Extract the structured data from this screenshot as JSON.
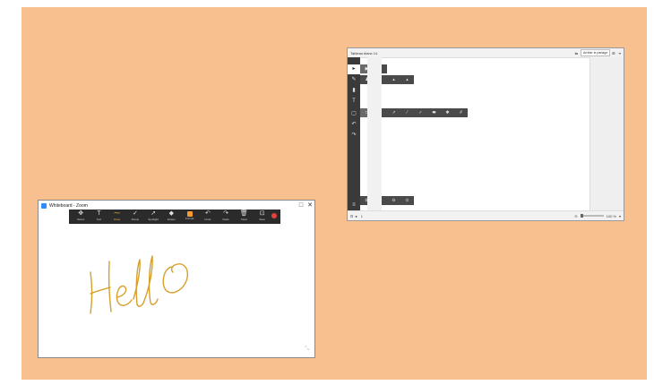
{
  "zoom_window": {
    "title": "Whiteboard - Zoom",
    "toolbar": [
      {
        "label": "Select",
        "icon": "move-icon",
        "glyph": "✥"
      },
      {
        "label": "Text",
        "icon": "text-icon",
        "glyph": "T"
      },
      {
        "label": "Draw",
        "icon": "draw-icon",
        "glyph": "⁓",
        "active": true
      },
      {
        "label": "Stamp",
        "icon": "stamp-icon",
        "glyph": "✓"
      },
      {
        "label": "Spotlight",
        "icon": "spotlight-icon",
        "glyph": "➚"
      },
      {
        "label": "Eraser",
        "icon": "eraser-icon",
        "glyph": "◆"
      },
      {
        "label": "Format",
        "icon": "format-icon",
        "glyph": ""
      },
      {
        "label": "Undo",
        "icon": "undo-icon",
        "glyph": "↶"
      },
      {
        "label": "Redo",
        "icon": "redo-icon",
        "glyph": "↷"
      },
      {
        "label": "Clear",
        "icon": "trash-icon",
        "glyph": "🗑"
      },
      {
        "label": "Save",
        "icon": "save-icon",
        "glyph": "⊡"
      }
    ],
    "drawing_text": "Hello",
    "ink_color": "#d6a02a"
  },
  "whiteboard_window": {
    "title": "Tableau blanc 14",
    "titlebar_buttons": [
      "Arrêter le partage"
    ],
    "side_tools": [
      {
        "icon": "pointer-icon",
        "glyph": "▸"
      },
      {
        "icon": "pen-icon",
        "glyph": "✎"
      },
      {
        "icon": "eraser-icon",
        "glyph": "▮"
      },
      {
        "icon": "text-icon",
        "glyph": "T"
      },
      {
        "icon": "shape-icon",
        "glyph": "▢"
      },
      {
        "icon": "undo-icon",
        "glyph": "↶"
      },
      {
        "icon": "redo-icon",
        "glyph": "↷"
      }
    ],
    "zoom_level": "100 %",
    "page_indicator": "1"
  },
  "colors": {
    "canvas": "#f8c08f",
    "zoom_toolbar": "#2b2b2b",
    "zoom_active": "#f2a93b",
    "close_red": "#e8413a",
    "wb_sidebar": "#3a3a3a"
  }
}
